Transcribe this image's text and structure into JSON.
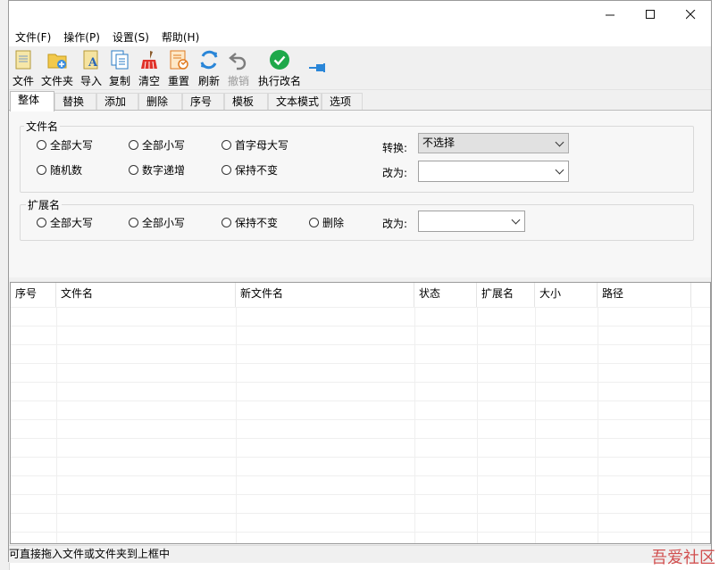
{
  "window": {
    "minimize_icon": "minimize-icon",
    "maximize_icon": "maximize-icon",
    "close_icon": "close-icon"
  },
  "menu": {
    "items": [
      {
        "label": "文件(F)"
      },
      {
        "label": "操作(P)"
      },
      {
        "label": "设置(S)"
      },
      {
        "label": "帮助(H)"
      }
    ]
  },
  "toolbar": {
    "buttons": [
      {
        "label": "文件",
        "icon": "file-icon"
      },
      {
        "label": "文件夹",
        "icon": "folder-add-icon"
      },
      {
        "label": "导入",
        "icon": "import-icon"
      },
      {
        "label": "复制",
        "icon": "copy-icon"
      },
      {
        "label": "清空",
        "icon": "broom-icon"
      },
      {
        "label": "重置",
        "icon": "reset-icon"
      },
      {
        "label": "刷新",
        "icon": "refresh-icon"
      },
      {
        "label": "撤销",
        "icon": "undo-icon"
      },
      {
        "label": "执行改名",
        "icon": "check-icon"
      }
    ],
    "pin_icon": "pin-icon"
  },
  "tabs": [
    {
      "label": "整体"
    },
    {
      "label": "替换"
    },
    {
      "label": "添加"
    },
    {
      "label": "删除"
    },
    {
      "label": "序号"
    },
    {
      "label": "模板"
    },
    {
      "label": "文本模式"
    },
    {
      "label": "选项"
    }
  ],
  "filename_group": {
    "title": "文件名",
    "options": [
      "全部大写",
      "全部小写",
      "首字母大写",
      "随机数",
      "数字递增",
      "保持不变"
    ],
    "convert_label": "转换:",
    "convert_value": "不选择",
    "change_label": "改为:",
    "change_value": ""
  },
  "ext_group": {
    "title": "扩展名",
    "options": [
      "全部大写",
      "全部小写",
      "保持不变",
      "删除"
    ],
    "change_label": "改为:",
    "change_value": ""
  },
  "grid": {
    "columns": [
      "序号",
      "文件名",
      "新文件名",
      "状态",
      "扩展名",
      "大小",
      "路径"
    ],
    "rows": []
  },
  "status": {
    "text": "可直接拖入文件或文件夹到上框中"
  },
  "watermark": "吾爱社区"
}
